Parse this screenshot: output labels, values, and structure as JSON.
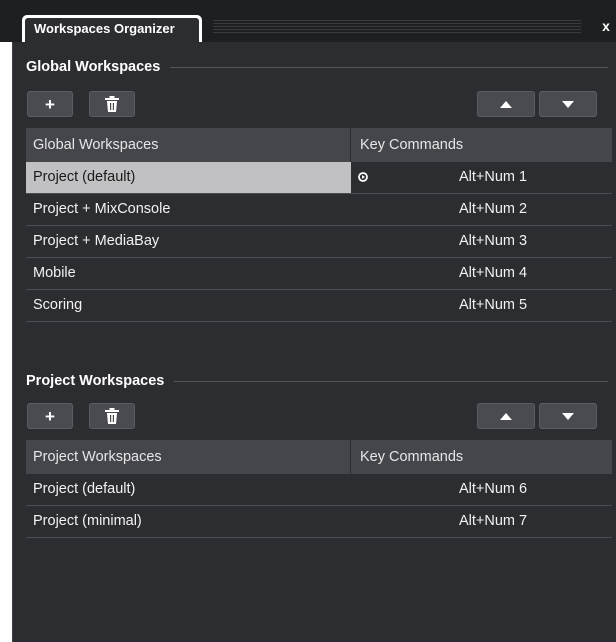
{
  "window": {
    "tab_title": "Workspaces Organizer",
    "close_label": "x"
  },
  "global": {
    "section_title": "Global Workspaces",
    "add_label": "+",
    "columns": {
      "name": "Global Workspaces",
      "key": "Key Commands"
    },
    "rows": [
      {
        "name": "Project (default)",
        "key": "Alt+Num 1"
      },
      {
        "name": "Project + MixConsole",
        "key": "Alt+Num 2"
      },
      {
        "name": "Project + MediaBay",
        "key": "Alt+Num 3"
      },
      {
        "name": "Mobile",
        "key": "Alt+Num 4"
      },
      {
        "name": "Scoring",
        "key": "Alt+Num 5"
      }
    ]
  },
  "project": {
    "section_title": "Project Workspaces",
    "add_label": "+",
    "columns": {
      "name": "Project Workspaces",
      "key": "Key Commands"
    },
    "rows": [
      {
        "name": "Project (default)",
        "key": "Alt+Num 6"
      },
      {
        "name": "Project (minimal)",
        "key": "Alt+Num 7"
      }
    ]
  },
  "icons": {
    "add": "plus-icon",
    "delete": "trash-icon",
    "move_up": "arrow-up-icon",
    "move_down": "arrow-down-icon",
    "active": "active-workspace-icon",
    "close": "close-icon"
  },
  "colors": {
    "panel_bg": "#2c2d30",
    "header_bg": "#45464b",
    "button_bg": "#4a4b50",
    "selection_bg": "#c1c1c3",
    "titlebar_bg": "#1e1f21"
  }
}
